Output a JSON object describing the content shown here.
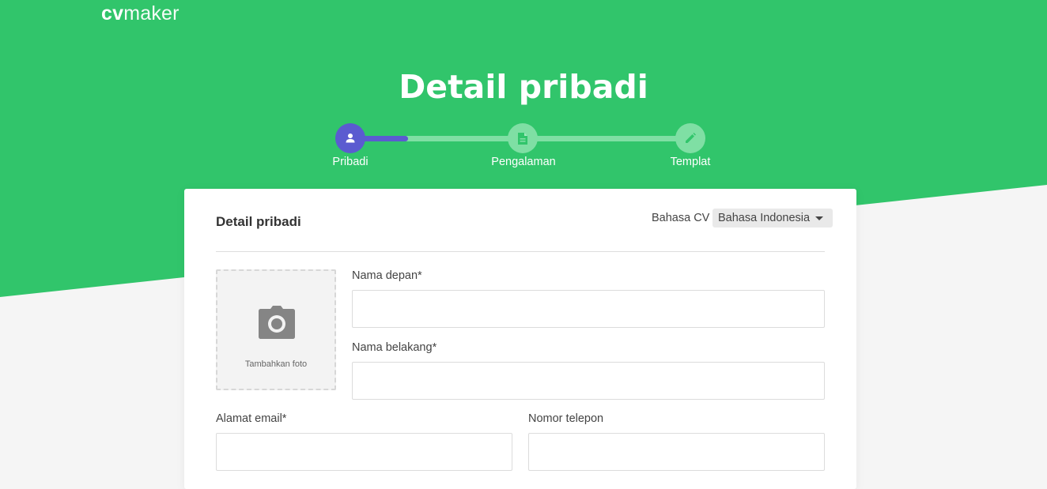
{
  "brand": {
    "bold": "cv",
    "light": "maker"
  },
  "page_title": "Detail pribadi",
  "stepper": {
    "progress": 0.17,
    "steps": [
      {
        "label": "Pribadi",
        "icon": "person-icon",
        "state": "active"
      },
      {
        "label": "Pengalaman",
        "icon": "document-icon",
        "state": "inactive"
      },
      {
        "label": "Templat",
        "icon": "pencil-icon",
        "state": "inactive"
      }
    ]
  },
  "card": {
    "title": "Detail pribadi",
    "language": {
      "label": "Bahasa CV",
      "selected": "Bahasa Indonesia"
    },
    "photo": {
      "label": "Tambahkan foto",
      "icon": "camera-icon"
    },
    "fields": {
      "first_name": {
        "label": "Nama depan*",
        "value": ""
      },
      "last_name": {
        "label": "Nama belakang*",
        "value": ""
      },
      "email": {
        "label": "Alamat email*",
        "value": ""
      },
      "phone": {
        "label": "Nomor telepon",
        "value": ""
      }
    }
  },
  "colors": {
    "brand_green": "#31c56b",
    "active_step": "#5b5bd0",
    "inactive_step": "#7fdfa4",
    "page_bg": "#f5f5f5"
  }
}
